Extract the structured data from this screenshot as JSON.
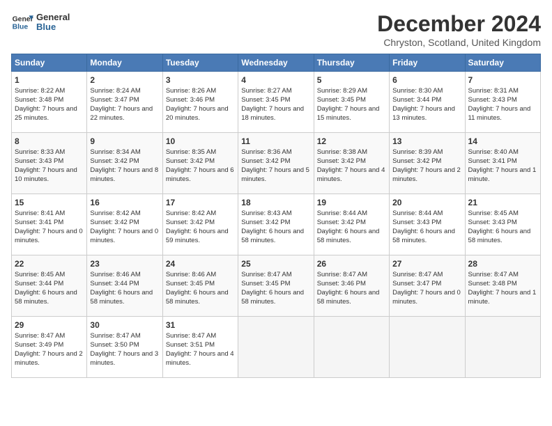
{
  "header": {
    "logo_line1": "General",
    "logo_line2": "Blue",
    "title": "December 2024",
    "subtitle": "Chryston, Scotland, United Kingdom"
  },
  "calendar": {
    "headers": [
      "Sunday",
      "Monday",
      "Tuesday",
      "Wednesday",
      "Thursday",
      "Friday",
      "Saturday"
    ],
    "weeks": [
      [
        null,
        {
          "day": 2,
          "sunrise": "8:24 AM",
          "sunset": "3:47 PM",
          "daylight": "7 hours and 22 minutes."
        },
        {
          "day": 3,
          "sunrise": "8:26 AM",
          "sunset": "3:46 PM",
          "daylight": "7 hours and 20 minutes."
        },
        {
          "day": 4,
          "sunrise": "8:27 AM",
          "sunset": "3:45 PM",
          "daylight": "7 hours and 18 minutes."
        },
        {
          "day": 5,
          "sunrise": "8:29 AM",
          "sunset": "3:45 PM",
          "daylight": "7 hours and 15 minutes."
        },
        {
          "day": 6,
          "sunrise": "8:30 AM",
          "sunset": "3:44 PM",
          "daylight": "7 hours and 13 minutes."
        },
        {
          "day": 7,
          "sunrise": "8:31 AM",
          "sunset": "3:43 PM",
          "daylight": "7 hours and 11 minutes."
        }
      ],
      [
        {
          "day": 1,
          "sunrise": "8:22 AM",
          "sunset": "3:48 PM",
          "daylight": "7 hours and 25 minutes."
        },
        null,
        null,
        null,
        null,
        null,
        null
      ],
      [
        {
          "day": 8,
          "sunrise": "8:33 AM",
          "sunset": "3:43 PM",
          "daylight": "7 hours and 10 minutes."
        },
        {
          "day": 9,
          "sunrise": "8:34 AM",
          "sunset": "3:42 PM",
          "daylight": "7 hours and 8 minutes."
        },
        {
          "day": 10,
          "sunrise": "8:35 AM",
          "sunset": "3:42 PM",
          "daylight": "7 hours and 6 minutes."
        },
        {
          "day": 11,
          "sunrise": "8:36 AM",
          "sunset": "3:42 PM",
          "daylight": "7 hours and 5 minutes."
        },
        {
          "day": 12,
          "sunrise": "8:38 AM",
          "sunset": "3:42 PM",
          "daylight": "7 hours and 4 minutes."
        },
        {
          "day": 13,
          "sunrise": "8:39 AM",
          "sunset": "3:42 PM",
          "daylight": "7 hours and 2 minutes."
        },
        {
          "day": 14,
          "sunrise": "8:40 AM",
          "sunset": "3:41 PM",
          "daylight": "7 hours and 1 minute."
        }
      ],
      [
        {
          "day": 15,
          "sunrise": "8:41 AM",
          "sunset": "3:41 PM",
          "daylight": "7 hours and 0 minutes."
        },
        {
          "day": 16,
          "sunrise": "8:42 AM",
          "sunset": "3:42 PM",
          "daylight": "7 hours and 0 minutes."
        },
        {
          "day": 17,
          "sunrise": "8:42 AM",
          "sunset": "3:42 PM",
          "daylight": "6 hours and 59 minutes."
        },
        {
          "day": 18,
          "sunrise": "8:43 AM",
          "sunset": "3:42 PM",
          "daylight": "6 hours and 58 minutes."
        },
        {
          "day": 19,
          "sunrise": "8:44 AM",
          "sunset": "3:42 PM",
          "daylight": "6 hours and 58 minutes."
        },
        {
          "day": 20,
          "sunrise": "8:44 AM",
          "sunset": "3:43 PM",
          "daylight": "6 hours and 58 minutes."
        },
        {
          "day": 21,
          "sunrise": "8:45 AM",
          "sunset": "3:43 PM",
          "daylight": "6 hours and 58 minutes."
        }
      ],
      [
        {
          "day": 22,
          "sunrise": "8:45 AM",
          "sunset": "3:44 PM",
          "daylight": "6 hours and 58 minutes."
        },
        {
          "day": 23,
          "sunrise": "8:46 AM",
          "sunset": "3:44 PM",
          "daylight": "6 hours and 58 minutes."
        },
        {
          "day": 24,
          "sunrise": "8:46 AM",
          "sunset": "3:45 PM",
          "daylight": "6 hours and 58 minutes."
        },
        {
          "day": 25,
          "sunrise": "8:47 AM",
          "sunset": "3:45 PM",
          "daylight": "6 hours and 58 minutes."
        },
        {
          "day": 26,
          "sunrise": "8:47 AM",
          "sunset": "3:46 PM",
          "daylight": "6 hours and 58 minutes."
        },
        {
          "day": 27,
          "sunrise": "8:47 AM",
          "sunset": "3:47 PM",
          "daylight": "7 hours and 0 minutes."
        },
        {
          "day": 28,
          "sunrise": "8:47 AM",
          "sunset": "3:48 PM",
          "daylight": "7 hours and 1 minute."
        }
      ],
      [
        {
          "day": 29,
          "sunrise": "8:47 AM",
          "sunset": "3:49 PM",
          "daylight": "7 hours and 2 minutes."
        },
        {
          "day": 30,
          "sunrise": "8:47 AM",
          "sunset": "3:50 PM",
          "daylight": "7 hours and 3 minutes."
        },
        {
          "day": 31,
          "sunrise": "8:47 AM",
          "sunset": "3:51 PM",
          "daylight": "7 hours and 4 minutes."
        },
        null,
        null,
        null,
        null
      ]
    ]
  }
}
